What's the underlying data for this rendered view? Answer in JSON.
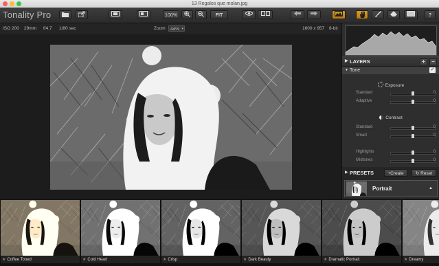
{
  "window": {
    "title": "13 Regalos que molan.jpg"
  },
  "toolbar": {
    "app_name": "Tonality Pro",
    "zoom_percent": "100%",
    "fit_label": "FIT"
  },
  "infobar": {
    "iso": "ISO 200",
    "focal": "29mm",
    "aperture": "f/4.7",
    "shutter": "1/80 sec",
    "zoom_label": "Zoom",
    "zoom_value": "44%",
    "dimensions": "1600 x 957",
    "bit_depth": "8-bit"
  },
  "layers": {
    "header": "LAYERS",
    "tone_label": "Tone",
    "exposure": {
      "title": "Exposure",
      "standard_label": "Standard",
      "standard_value": "0",
      "adaptive_label": "Adaptive",
      "adaptive_value": "0"
    },
    "contrast": {
      "title": "Contrast",
      "standard_label": "Standard",
      "standard_value": "0",
      "smart_label": "Smart",
      "smart_value": "0"
    },
    "highlights_label": "Highlights",
    "highlights_value": "0",
    "midtones_label": "Midtones",
    "midtones_value": "0"
  },
  "presets": {
    "header": "PRESETS",
    "create_label": "Create",
    "reset_label": "Reset",
    "current_category": "Portrait"
  },
  "filmstrip": {
    "items": [
      {
        "label": "Coffee Toned"
      },
      {
        "label": "Cold Heart"
      },
      {
        "label": "Crisp"
      },
      {
        "label": "Dark Beauty"
      },
      {
        "label": "Dramatic Portrait"
      },
      {
        "label": "Dreamy"
      }
    ]
  },
  "colors": {
    "accent": "#d99a2a",
    "panel_bg": "#2e2e2e",
    "toolbar_bg": "#333333"
  }
}
